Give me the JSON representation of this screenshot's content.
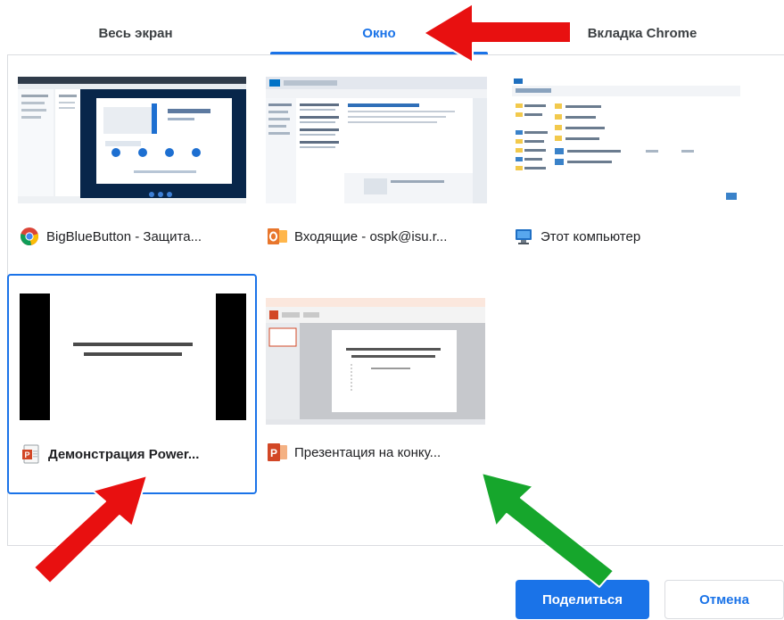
{
  "tabs": [
    {
      "label": "Весь экран",
      "active": false
    },
    {
      "label": "Окно",
      "active": true
    },
    {
      "label": "Вкладка Chrome",
      "active": false
    }
  ],
  "windows": [
    {
      "label": "BigBlueButton - Защита...",
      "icon": "chrome-icon",
      "selected": false,
      "bold": false
    },
    {
      "label": "Входящие - ospk@isu.r...",
      "icon": "outlook-icon",
      "selected": false,
      "bold": false
    },
    {
      "label": "Этот компьютер",
      "icon": "computer-icon",
      "selected": false,
      "bold": false
    },
    {
      "label": "Демонстрация Power...",
      "icon": "powerpoint-show-icon",
      "selected": true,
      "bold": true
    },
    {
      "label": "Презентация на конку...",
      "icon": "powerpoint-icon",
      "selected": false,
      "bold": false
    }
  ],
  "buttons": {
    "share_label": "Поделиться",
    "cancel_label": "Отмена"
  },
  "annotations": {
    "arrow_red_color": "#e81010",
    "arrow_green_color": "#16a62c"
  },
  "colors": {
    "accent": "#1a73e8",
    "divider": "#dadce0"
  }
}
